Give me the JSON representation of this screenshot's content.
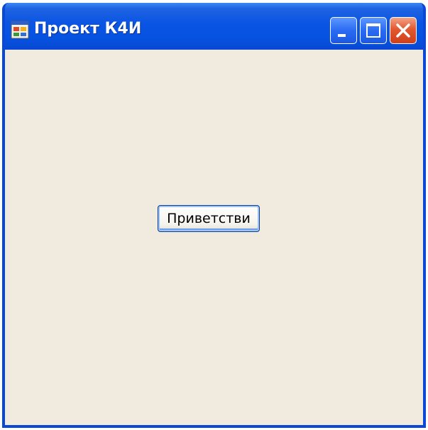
{
  "window": {
    "title": "Проект К4И",
    "icon": "app-window-icon",
    "controls": {
      "minimize_icon": "minimize-icon",
      "maximize_icon": "maximize-icon",
      "close_icon": "close-icon"
    }
  },
  "main": {
    "greet_button_label": "Приветстви"
  },
  "colors": {
    "titlebar": "#0652e1",
    "frame": "#0a48d8",
    "client_background": "#f1eadf",
    "close_button": "#e3582f"
  }
}
